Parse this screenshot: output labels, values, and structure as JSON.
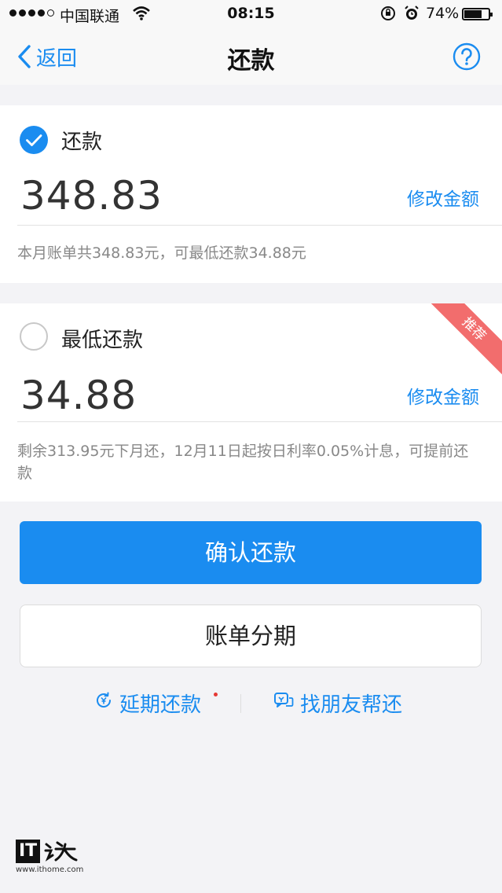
{
  "status_bar": {
    "carrier": "中国联通",
    "time": "08:15",
    "battery": "74%",
    "battery_level": 0.74
  },
  "nav": {
    "back_label": "返回",
    "title": "还款"
  },
  "options": {
    "full": {
      "label": "还款",
      "amount": "348.83",
      "edit_label": "修改金额",
      "note": "本月账单共348.83元，可最低还款34.88元",
      "selected": true
    },
    "minimum": {
      "label": "最低还款",
      "amount": "34.88",
      "edit_label": "修改金额",
      "note": "剩余313.95元下月还，12月11日起按日利率0.05%计息，可提前还款",
      "badge": "推荐",
      "selected": false
    }
  },
  "buttons": {
    "confirm": "确认还款",
    "installment": "账单分期"
  },
  "links": {
    "defer": "延期还款",
    "friend": "找朋友帮还"
  },
  "watermark": {
    "logo_text": "IT之家",
    "url": "www.ithome.com"
  },
  "colors": {
    "accent": "#1a8cf0",
    "badge": "#f26d6d",
    "background": "#f3f3f6"
  }
}
